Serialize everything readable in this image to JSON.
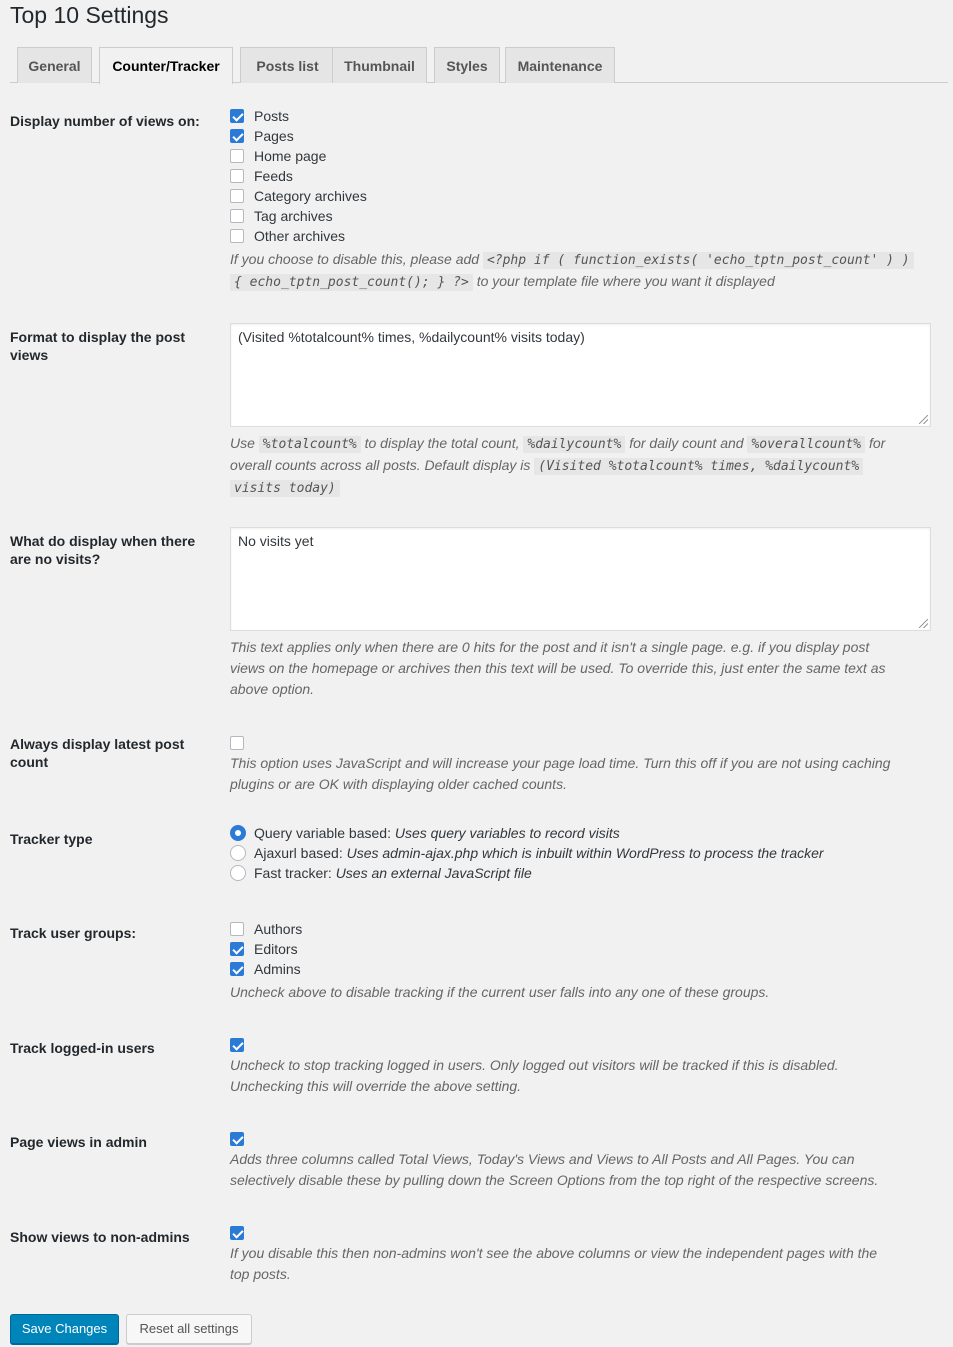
{
  "page_title": "Top 10 Settings",
  "tabs": [
    "General",
    "Counter/Tracker",
    "Posts list",
    "Thumbnail",
    "Styles",
    "Maintenance"
  ],
  "active_tab": "Counter/Tracker",
  "display_views": {
    "label": "Display number of views on:",
    "options": [
      {
        "label": "Posts",
        "checked": true
      },
      {
        "label": "Pages",
        "checked": true
      },
      {
        "label": "Home page",
        "checked": false
      },
      {
        "label": "Feeds",
        "checked": false
      },
      {
        "label": "Category archives",
        "checked": false
      },
      {
        "label": "Tag archives",
        "checked": false
      },
      {
        "label": "Other archives",
        "checked": false
      }
    ],
    "desc_before": "If you choose to disable this, please add",
    "code_1": "<?php if ( function_exists( 'echo_tptn_post_count' ) )",
    "code_2": "{ echo_tptn_post_count(); } ?>",
    "desc_after": "to your template file where you want it displayed"
  },
  "format": {
    "label": "Format to display the post views",
    "value": "(Visited %totalcount% times, %dailycount% visits today)",
    "desc_use": "Use",
    "code_total": "%totalcount%",
    "desc_total": "to display the total count,",
    "code_daily": "%dailycount%",
    "desc_daily": "for daily count and",
    "code_overall": "%overallcount%",
    "desc_for": "for",
    "desc_overall": "overall counts across all posts. Default display is",
    "code_default_1": "(Visited %totalcount% times, %dailycount%",
    "code_default_2": "visits today)"
  },
  "no_visits": {
    "label": "What do display when there are no visits?",
    "value": "No visits yet",
    "desc_1": "This text applies only when there are 0 hits for the post and it isn't a single page. e.g. if you display post",
    "desc_2": "views on the homepage or archives then this text will be used. To override this, just enter the same text as",
    "desc_3": "above option."
  },
  "always_latest": {
    "label": "Always display latest post count",
    "checked": false,
    "desc_1": "This option uses JavaScript and will increase your page load time. Turn this off if you are not using caching",
    "desc_2": "plugins or are OK with displaying older cached counts."
  },
  "tracker_type": {
    "label": "Tracker type",
    "options": [
      {
        "name": "Query variable based:",
        "desc": "Uses query variables to record visits",
        "checked": true
      },
      {
        "name": "Ajaxurl based:",
        "desc": "Uses admin-ajax.php which is inbuilt within WordPress to process the tracker",
        "checked": false
      },
      {
        "name": "Fast tracker:",
        "desc": "Uses an external JavaScript file",
        "checked": false
      }
    ]
  },
  "track_groups": {
    "label": "Track user groups:",
    "options": [
      {
        "label": "Authors",
        "checked": false
      },
      {
        "label": "Editors",
        "checked": true
      },
      {
        "label": "Admins",
        "checked": true
      }
    ],
    "desc": "Uncheck above to disable tracking if the current user falls into any one of these groups."
  },
  "track_logged": {
    "label": "Track logged-in users",
    "checked": true,
    "desc_1": "Uncheck to stop tracking logged in users. Only logged out visitors will be tracked if this is disabled.",
    "desc_2": "Unchecking this will override the above setting."
  },
  "page_views_admin": {
    "label": "Page views in admin",
    "checked": true,
    "desc_1": "Adds three columns called Total Views, Today's Views and Views to All Posts and All Pages. You can",
    "desc_2": "selectively disable these by pulling down the Screen Options from the top right of the respective screens."
  },
  "show_non_admins": {
    "label": "Show views to non-admins",
    "checked": true,
    "desc_1": "If you disable this then non-admins won't see the above columns or view the independent pages with the",
    "desc_2": "top posts."
  },
  "buttons": {
    "save": "Save Changes",
    "reset": "Reset all settings"
  },
  "colors": {
    "primary": "#0085ba",
    "checkbox_checked": "#2b7bd6",
    "background": "#f1f1f1"
  }
}
